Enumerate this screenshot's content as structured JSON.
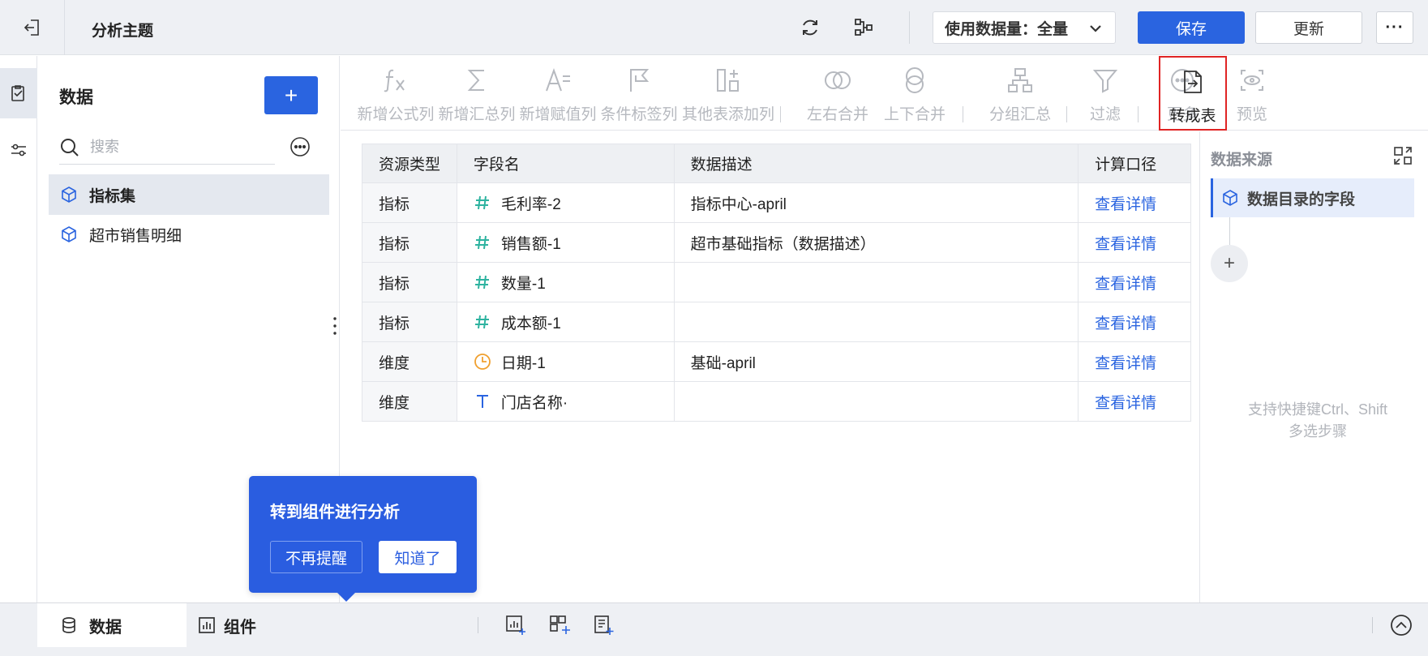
{
  "header": {
    "title": "分析主题",
    "data_volume": "使用数据量：全量",
    "save_label": "保存",
    "update_label": "更新",
    "more_label": "···"
  },
  "left_panel": {
    "title": "数据",
    "add_label": "+",
    "search_placeholder": "搜索",
    "items": [
      {
        "label": "指标集",
        "selected": true
      },
      {
        "label": "超市销售明细",
        "selected": false
      }
    ]
  },
  "toolbar": {
    "tools": [
      {
        "label": "新增公式列",
        "icon": "formula-icon"
      },
      {
        "label": "新增汇总列",
        "icon": "sum-icon"
      },
      {
        "label": "新增赋值列",
        "icon": "assign-icon"
      },
      {
        "label": "条件标签列",
        "icon": "flag-icon"
      },
      {
        "label": "其他表添加列",
        "icon": "add-column-icon"
      },
      {
        "label": "左右合并",
        "icon": "join-icon"
      },
      {
        "label": "上下合并",
        "icon": "union-icon"
      },
      {
        "label": "分组汇总",
        "icon": "group-icon"
      },
      {
        "label": "过滤",
        "icon": "filter-icon"
      },
      {
        "label": "更多",
        "icon": "more-icon"
      },
      {
        "label": "转成表",
        "icon": "convert-icon"
      },
      {
        "label": "预览",
        "icon": "preview-icon"
      }
    ]
  },
  "table": {
    "headers": [
      "资源类型",
      "字段名",
      "数据描述",
      "计算口径"
    ],
    "rows": [
      {
        "type": "指标",
        "field": "毛利率-2",
        "icon": "number-icon",
        "desc": "指标中心-april",
        "link": "查看详情"
      },
      {
        "type": "指标",
        "field": "销售额-1",
        "icon": "number-icon",
        "desc": "超市基础指标（数据描述）",
        "link": "查看详情"
      },
      {
        "type": "指标",
        "field": "数量-1",
        "icon": "number-icon",
        "desc": "",
        "link": "查看详情"
      },
      {
        "type": "指标",
        "field": "成本额-1",
        "icon": "number-icon",
        "desc": "",
        "link": "查看详情"
      },
      {
        "type": "维度",
        "field": "日期-1",
        "icon": "date-icon",
        "desc": "基础-april",
        "link": "查看详情"
      },
      {
        "type": "维度",
        "field": "门店名称·",
        "icon": "text-icon",
        "desc": "",
        "link": "查看详情"
      }
    ]
  },
  "right_panel": {
    "title": "数据来源",
    "source_label": "数据目录的字段",
    "add_label": "+",
    "hint_line1": "支持快捷键Ctrl、Shift",
    "hint_line2": "多选步骤"
  },
  "tooltip": {
    "title": "转到组件进行分析",
    "dismiss_label": "不再提醒",
    "ok_label": "知道了"
  },
  "bottom": {
    "data_tab": "数据",
    "component_tab": "组件"
  },
  "colors": {
    "primary": "#2a64e0",
    "number_icon": "#2eb3a0",
    "date_icon": "#f0a030",
    "highlight_border": "#e02424"
  }
}
